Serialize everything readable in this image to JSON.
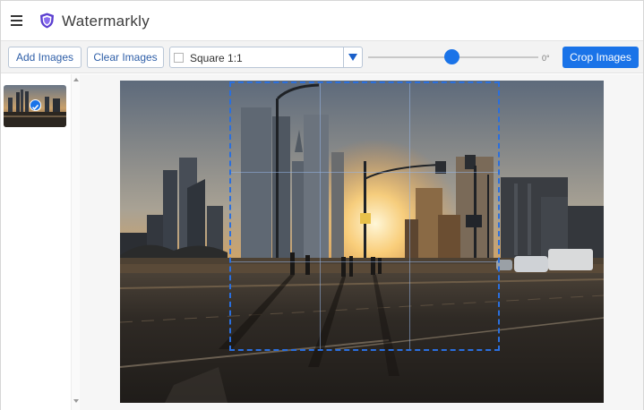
{
  "app": {
    "title": "Watermarkly"
  },
  "toolbar": {
    "add_label": "Add Images",
    "clear_label": "Clear Images",
    "aspect_value": "Square 1:1",
    "rotation_value": 0.49,
    "rotation_label": "0°",
    "crop_label": "Crop Images"
  },
  "colors": {
    "accent": "#1a73e8",
    "crop_border": "#2a6fde"
  },
  "icons": [
    "hamburger-icon",
    "shield-logo-icon",
    "chevron-down-icon",
    "check-icon",
    "scroll-up-icon",
    "scroll-down-icon"
  ]
}
